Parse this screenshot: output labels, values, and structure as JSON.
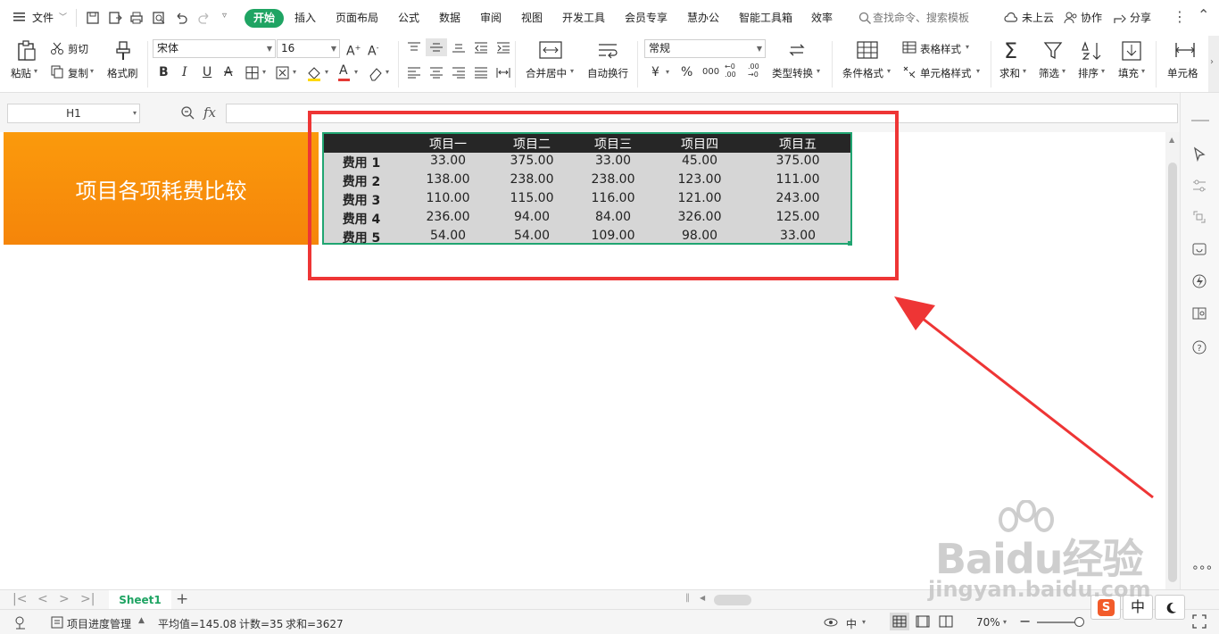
{
  "menubar": {
    "file_label": "文件",
    "tabs": [
      "开始",
      "插入",
      "页面布局",
      "公式",
      "数据",
      "审阅",
      "视图",
      "开发工具",
      "会员专享",
      "慧办公",
      "智能工具箱",
      "效率"
    ],
    "search_placeholder": "查找命令、搜索模板",
    "cloud_label": "未上云",
    "collab_label": "协作",
    "share_label": "分享"
  },
  "ribbon": {
    "paste": "粘贴",
    "cut": "剪切",
    "copy": "复制",
    "format_painter": "格式刷",
    "font_name": "宋体",
    "font_size": "16",
    "merge_center": "合并居中",
    "wrap_text": "自动换行",
    "number_format": "常规",
    "type_convert": "类型转换",
    "conditional_format": "条件格式",
    "table_style": "表格样式",
    "cell_style": "单元格样式",
    "sum": "求和",
    "filter": "筛选",
    "sort": "排序",
    "fill": "填充",
    "cell": "单元格"
  },
  "formula": {
    "name_box": "H1",
    "fx_label": "fx",
    "content": ""
  },
  "sheet": {
    "banner_title": "项目各项耗费比较",
    "columns": [
      "项目一",
      "项目二",
      "项目三",
      "项目四",
      "项目五"
    ],
    "rows": [
      {
        "label": "费用 1",
        "values": [
          "33.00",
          "375.00",
          "33.00",
          "45.00",
          "375.00"
        ]
      },
      {
        "label": "费用 2",
        "values": [
          "138.00",
          "238.00",
          "238.00",
          "123.00",
          "111.00"
        ]
      },
      {
        "label": "费用 3",
        "values": [
          "110.00",
          "115.00",
          "116.00",
          "121.00",
          "243.00"
        ]
      },
      {
        "label": "费用 4",
        "values": [
          "236.00",
          "94.00",
          "84.00",
          "326.00",
          "125.00"
        ]
      },
      {
        "label": "费用 5",
        "values": [
          "54.00",
          "54.00",
          "109.00",
          "98.00",
          "33.00"
        ]
      }
    ]
  },
  "tabs": {
    "sheet_name": "Sheet1"
  },
  "status": {
    "doc_name": "项目进度管理",
    "average": "平均值=145.08",
    "count": "计数=35",
    "sum": "求和=3627",
    "zoom": "70%",
    "ime_label": "中"
  },
  "watermark": {
    "brand": "Baidu经验",
    "url": "jingyan.baidu.com"
  },
  "colors": {
    "accent": "#1fa463",
    "banner": "#fb9a0c",
    "annotation": "#ee3535"
  }
}
